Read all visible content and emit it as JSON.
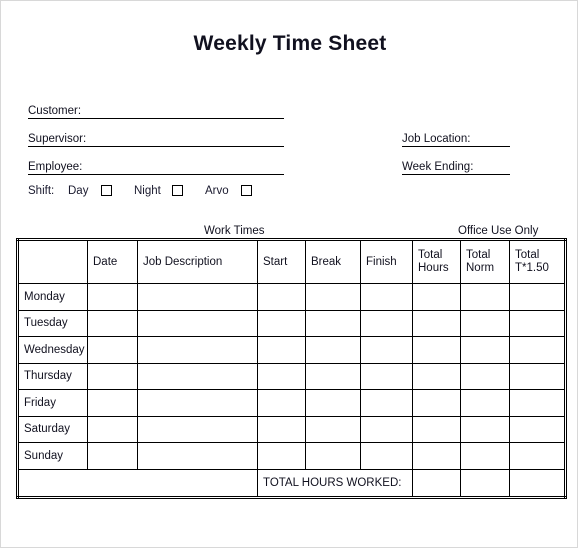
{
  "document": {
    "title": "Weekly Time Sheet"
  },
  "form": {
    "left_fields": [
      {
        "label": "Customer:",
        "value": ""
      },
      {
        "label": "Supervisor:",
        "value": ""
      },
      {
        "label": "Employee:",
        "value": ""
      }
    ],
    "right_fields": [
      {
        "label": "Job Location:",
        "value": ""
      },
      {
        "label": "Week Ending:",
        "value": ""
      }
    ],
    "shift": {
      "label": "Shift:",
      "options": [
        {
          "label": "Day",
          "checked": false
        },
        {
          "label": "Night",
          "checked": false
        },
        {
          "label": "Arvo",
          "checked": false
        }
      ]
    }
  },
  "table": {
    "section_captions": {
      "work_times": "Work Times",
      "office_use": "Office Use Only"
    },
    "columns": [
      {
        "key": "day",
        "label": ""
      },
      {
        "key": "date",
        "label": "Date"
      },
      {
        "key": "job_description",
        "label": "Job Description"
      },
      {
        "key": "start",
        "label": "Start"
      },
      {
        "key": "break",
        "label": "Break"
      },
      {
        "key": "finish",
        "label": "Finish"
      },
      {
        "key": "total_hours",
        "label_line1": "Total",
        "label_line2": "Hours"
      },
      {
        "key": "total_norm",
        "label_line1": "Total",
        "label_line2": "Norm"
      },
      {
        "key": "total_t150",
        "label_line1": "Total",
        "label_line2": "T*1.50"
      }
    ],
    "rows": [
      {
        "day": "Monday",
        "date": "",
        "job_description": "",
        "start": "",
        "break": "",
        "finish": "",
        "total_hours": "",
        "total_norm": "",
        "total_t150": ""
      },
      {
        "day": "Tuesday",
        "date": "",
        "job_description": "",
        "start": "",
        "break": "",
        "finish": "",
        "total_hours": "",
        "total_norm": "",
        "total_t150": ""
      },
      {
        "day": "Wednesday",
        "date": "",
        "job_description": "",
        "start": "",
        "break": "",
        "finish": "",
        "total_hours": "",
        "total_norm": "",
        "total_t150": ""
      },
      {
        "day": "Thursday",
        "date": "",
        "job_description": "",
        "start": "",
        "break": "",
        "finish": "",
        "total_hours": "",
        "total_norm": "",
        "total_t150": ""
      },
      {
        "day": "Friday",
        "date": "",
        "job_description": "",
        "start": "",
        "break": "",
        "finish": "",
        "total_hours": "",
        "total_norm": "",
        "total_t150": ""
      },
      {
        "day": "Saturday",
        "date": "",
        "job_description": "",
        "start": "",
        "break": "",
        "finish": "",
        "total_hours": "",
        "total_norm": "",
        "total_t150": ""
      },
      {
        "day": "Sunday",
        "date": "",
        "job_description": "",
        "start": "",
        "break": "",
        "finish": "",
        "total_hours": "",
        "total_norm": "",
        "total_t150": ""
      }
    ],
    "footer": {
      "label": "TOTAL HOURS WORKED:",
      "total_hours": "",
      "total_norm": "",
      "total_t150": ""
    }
  },
  "colors": {
    "text": "#11111f",
    "rule": "#000000",
    "page_border": "#d8d8d8",
    "background": "#ffffff"
  }
}
